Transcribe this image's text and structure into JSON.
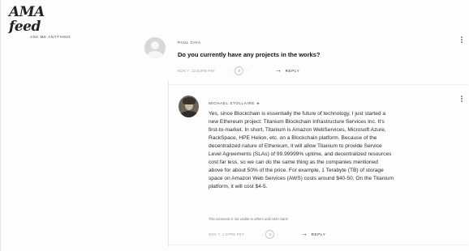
{
  "site": {
    "logo_text": "AMA feed",
    "tagline": "ASK ME ANYTHING"
  },
  "comments": [
    {
      "author": "PAUL CHIA",
      "text": "Do you currently have any projects in the works?",
      "date": "NOV 7, 12:52PM PST",
      "votes": "0",
      "reply_label": "REPLY"
    },
    {
      "author": "MICHAEL STOLLAIRE",
      "badge": "★",
      "lines": [
        "Yes, since Blockchain is essentially the future of technology, I just started a",
        "new Ethereum project: Titanium Blockchain Infrastructure Services Inc. It's",
        "first-to-market. In short, Titanium is Amazon WebServices, Microsoft Azure,",
        "RackSpace, HPE Helion, etc. on a Blockchain platform. Because of the",
        "decentralized nature of Ethereum, it will allow Titanium to provide Service",
        "Level Agreements (SLAs) of 99.99999% uptime, and decentralized resources",
        "cost far less, so we can do the same thing as the companies mentioned",
        "above for about 50% of the price. For example, 1 Terabyte (TB) of storage",
        "space on Amazon Web Services (AWS) costs around $40-50. On the Titanium",
        "platform, it will cost $4-5."
      ],
      "note": "This comment is not visible to others until AMA starts",
      "date": "NOV 7, 1:07PM PST",
      "votes": "0",
      "reply_label": "REPLY"
    }
  ],
  "icons": {
    "reply": "reply-arrow-icon",
    "more": "more-vertical-icon",
    "avatar": "default-avatar-icon"
  }
}
